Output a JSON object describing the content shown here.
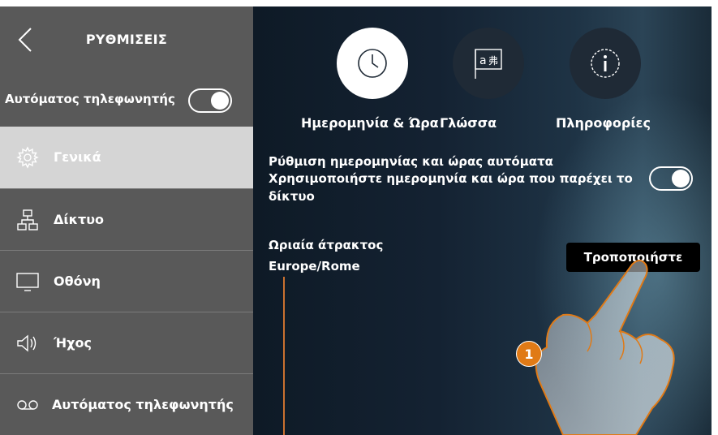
{
  "sidebar": {
    "title": "ΡΥΘΜΙΣΕΙΣ",
    "answering_machine": {
      "label": "Αυτόματος τηλεφωνητής",
      "enabled": true
    },
    "items": [
      {
        "label": "Γενικά",
        "icon": "gear-icon",
        "active": true
      },
      {
        "label": "Δίκτυο",
        "icon": "network-icon",
        "active": false
      },
      {
        "label": "Οθόνη",
        "icon": "monitor-icon",
        "active": false
      },
      {
        "label": "Ήχος",
        "icon": "speaker-icon",
        "active": false
      },
      {
        "label": "Αυτόματος τηλεφωνητής",
        "icon": "voicemail-icon",
        "active": false
      }
    ]
  },
  "tabs": [
    {
      "label": "Ημερομηνία & Ώρα",
      "icon": "clock-icon",
      "active": true
    },
    {
      "label": "Γλώσσα",
      "icon": "language-flag-icon",
      "active": false
    },
    {
      "label": "Πληροφορίες",
      "icon": "info-icon",
      "active": false
    }
  ],
  "settings": {
    "auto_datetime_title": "Ρύθμιση ημερομηνίας και ώρας αυτόματα",
    "auto_datetime_desc": "Χρησιμοποιήστε ημερομηνία και ώρα που παρέχει το δίκτυο",
    "auto_datetime_enabled": true,
    "timezone_label": "Ωριαία άτρακτος",
    "timezone_value": "Europe/Rome",
    "modify_button": "Τροποποιήστε"
  },
  "annotation": {
    "step": "1"
  },
  "colors": {
    "sidebar_bg": "#595959",
    "sidebar_active_bg": "#d5d5d5",
    "accent_orange": "#e07a16",
    "main_bg": "#142232"
  }
}
